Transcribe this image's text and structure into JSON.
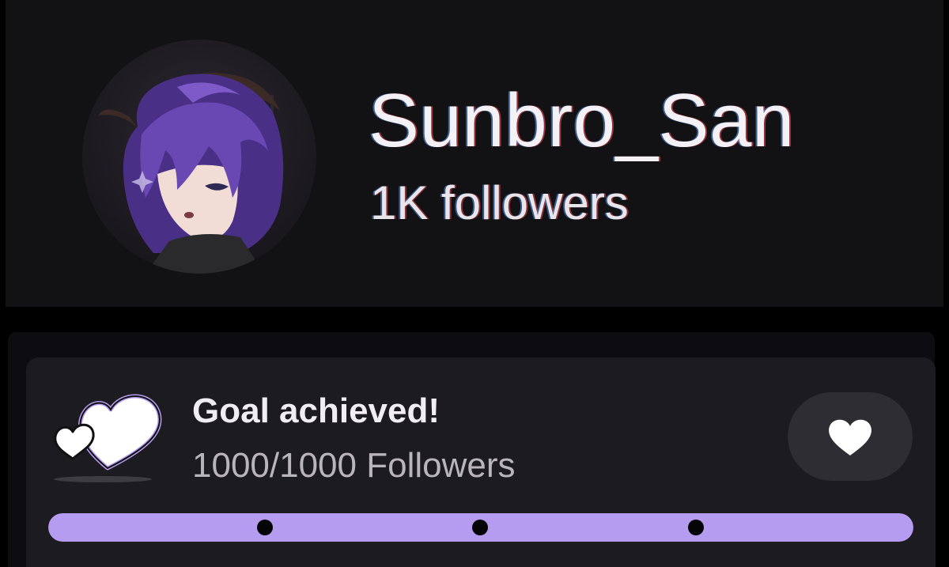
{
  "profile": {
    "username": "Sunbro_San",
    "followers_label": "1K followers",
    "avatar_icon": "avatar-anime-character"
  },
  "goal": {
    "title": "Goal achieved!",
    "count_label": "1000/1000 Followers",
    "current": 1000,
    "target": 1000,
    "progress_fraction": 1.0,
    "milestones_count": 3,
    "icon": "double-heart-icon",
    "button_icon": "heart-icon"
  },
  "colors": {
    "background": "#000000",
    "panel": "#121114",
    "card": "#1c1b1f",
    "accent": "#b69cf0",
    "button": "#2e2d33",
    "hair": "#5e3fa0"
  }
}
